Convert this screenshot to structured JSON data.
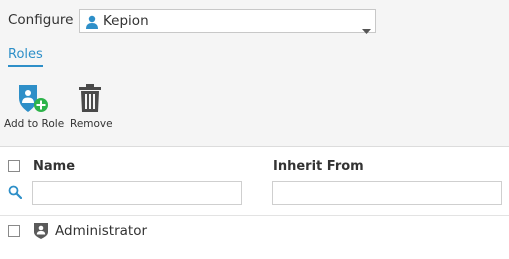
{
  "configure": {
    "label": "Configure",
    "selected_value": "Kepion",
    "selected_icon": "user-icon"
  },
  "tabs": [
    {
      "label": "Roles",
      "active": true
    }
  ],
  "toolbar": {
    "add_to_role": {
      "label": "Add to Role",
      "icon": "shield-add-icon"
    },
    "remove": {
      "label": "Remove",
      "icon": "trash-icon"
    }
  },
  "grid": {
    "columns": [
      {
        "label": "Name"
      },
      {
        "label": "Inherit From"
      }
    ],
    "rows": [
      {
        "name": "Administrator",
        "icon": "shield-user-icon",
        "checked": false
      }
    ]
  },
  "colors": {
    "accent": "#2e8fc8",
    "add_badge": "#2db34a",
    "trash": "#4a4a4a"
  }
}
